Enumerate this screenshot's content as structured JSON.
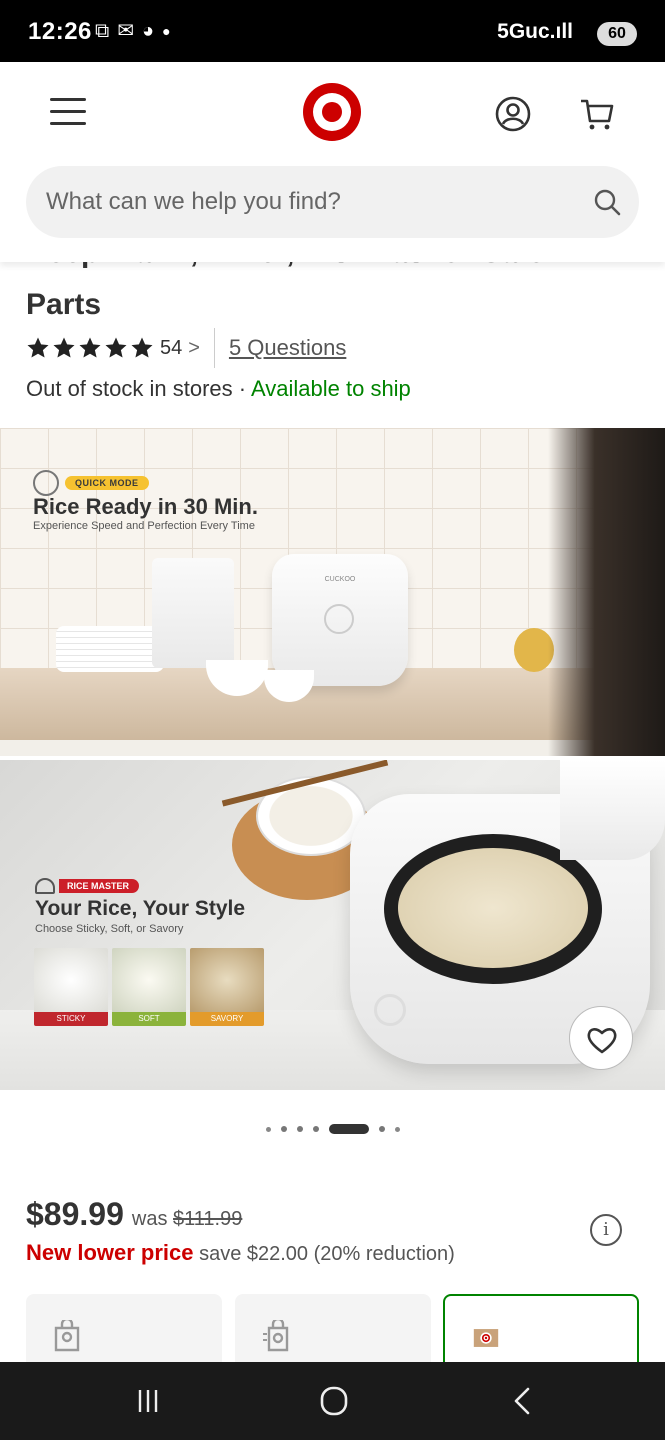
{
  "status_bar": {
    "time": "12:26",
    "network": "5Guc.ıll",
    "battery": "60"
  },
  "header": {
    "search": {
      "placeholder": "What can we help you find?"
    }
  },
  "product": {
    "title_line1": "Keep Warm, Timer, Dishwasher-Safe",
    "title_line2": "Parts",
    "rating_count": "54",
    "rating_chevron": ">",
    "questions_link": "5 Questions",
    "stock_text": "Out of stock in stores · ",
    "available_text": "Available to ship"
  },
  "gallery": {
    "image1": {
      "badge": "QUICK MODE",
      "headline": "Rice Ready in 30 Min.",
      "subline": "Experience Speed and Perfection Every Time",
      "brand": "CUCKOO"
    },
    "image2": {
      "badge": "RICE MASTER",
      "headline": "Your Rice, Your Style",
      "subline": "Choose Sticky, Soft, or Savory",
      "thumbs": [
        {
          "label": "STICKY",
          "color": "#c0272d"
        },
        {
          "label": "SOFT",
          "color": "#8bb33b"
        },
        {
          "label": "SAVORY",
          "color": "#e39b2b"
        }
      ]
    },
    "dots": {
      "count": 7,
      "active_index": 4
    }
  },
  "pricing": {
    "current": "$89.99",
    "was_label": "was",
    "was_price": "$111.99",
    "new_lower": "New lower price",
    "save_text": "save $22.00 (20% reduction)",
    "info": "i"
  },
  "colors": {
    "brand_red": "#cc0000",
    "available_green": "#008300",
    "text": "#333333"
  },
  "icons": {
    "menu": "hamburger-icon",
    "logo": "target-logo",
    "account": "account-icon",
    "cart": "cart-icon",
    "search": "search-icon",
    "favorite": "heart-icon"
  }
}
